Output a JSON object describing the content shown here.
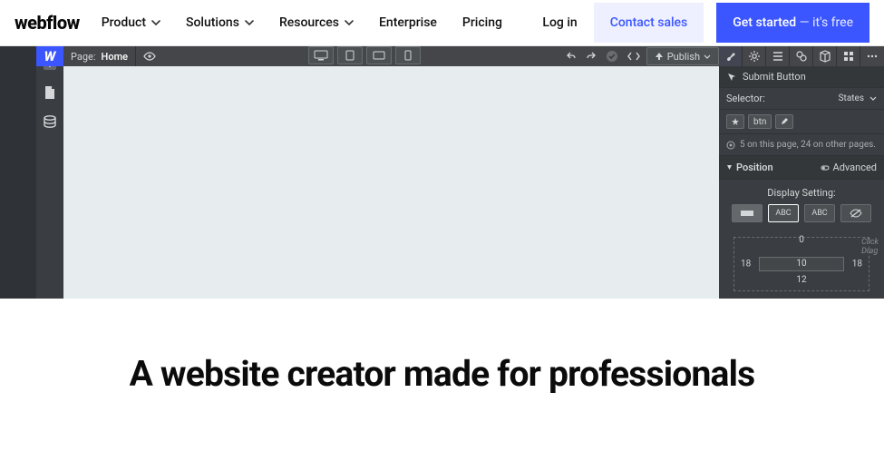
{
  "nav": {
    "logo": "webflow",
    "items": [
      {
        "label": "Product",
        "dropdown": true
      },
      {
        "label": "Solutions",
        "dropdown": true
      },
      {
        "label": "Resources",
        "dropdown": true
      },
      {
        "label": "Enterprise",
        "dropdown": false
      },
      {
        "label": "Pricing",
        "dropdown": false
      }
    ],
    "login": "Log in",
    "contact": "Contact sales",
    "get_started": "Get started",
    "get_started_suffix": " — it's free"
  },
  "designer": {
    "page_label": "Page:",
    "page_name": "Home",
    "publish": "Publish",
    "style": {
      "element_label": "Submit Button",
      "selector_label": "Selector:",
      "states_label": "States",
      "class_name": "btn",
      "usage_note": "5 on this page, 24 on other pages.",
      "section_position": "Position",
      "advanced": "Advanced",
      "display_setting": "Display Setting:",
      "opt_abc1": "ABC",
      "opt_abc2": "ABC",
      "box": {
        "top": "0",
        "inner_top": "10",
        "inner_bottom": "12",
        "left": "18",
        "right": "18"
      },
      "hand_note_1": "Click",
      "hand_note_2": "Drag"
    }
  },
  "hero": {
    "headline": "A website creator made for professionals"
  }
}
